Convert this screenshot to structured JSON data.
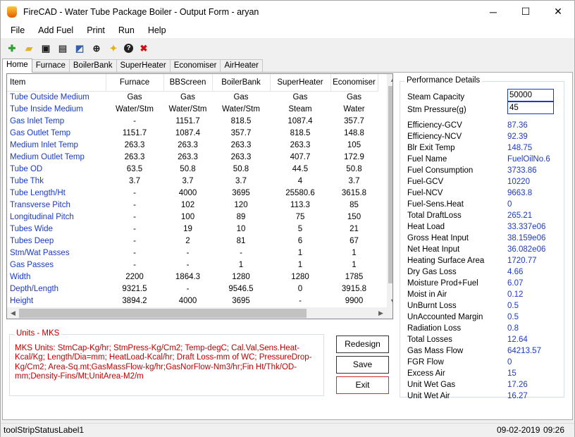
{
  "window": {
    "title": "FireCAD - Water Tube Package Boiler - Output Form - aryan",
    "minimize": "─",
    "maximize": "☐",
    "close": "✕"
  },
  "menu": [
    "File",
    "Add Fuel",
    "Print",
    "Run",
    "Help"
  ],
  "toolbar": [
    {
      "icon": "new-icon",
      "glyph": "✚",
      "color": "#2e9e2e"
    },
    {
      "icon": "open-folder-icon",
      "glyph": "▰",
      "color": "#e0b030"
    },
    {
      "icon": "save-icon",
      "glyph": "▣",
      "color": "#1a1a1a"
    },
    {
      "icon": "print-icon",
      "glyph": "▤",
      "color": "#444"
    },
    {
      "icon": "chart-icon",
      "glyph": "◩",
      "color": "#3060b0"
    },
    {
      "icon": "add-icon",
      "glyph": "⊕",
      "color": "#222"
    },
    {
      "icon": "run-icon",
      "glyph": "✦",
      "color": "#e8b000"
    },
    {
      "icon": "help-icon",
      "glyph": "?",
      "color": "#222"
    },
    {
      "icon": "close-icon",
      "glyph": "✖",
      "color": "#d01010"
    }
  ],
  "tabs": [
    "Home",
    "Furnace",
    "BoilerBank",
    "SuperHeater",
    "Economiser",
    "AirHeater"
  ],
  "grid": {
    "columns": [
      "Item",
      "Furnace",
      "BBScreen",
      "BoilerBank",
      "SuperHeater",
      "Economiser"
    ],
    "rows": [
      [
        "Tube Outside Medium",
        "Gas",
        "Gas",
        "Gas",
        "Gas",
        "Gas"
      ],
      [
        "Tube Inside Medium",
        "Water/Stm",
        "Water/Stm",
        "Water/Stm",
        "Steam",
        "Water"
      ],
      [
        "Gas Inlet Temp",
        "-",
        "1151.7",
        "818.5",
        "1087.4",
        "357.7"
      ],
      [
        "Gas Outlet Temp",
        "1151.7",
        "1087.4",
        "357.7",
        "818.5",
        "148.8"
      ],
      [
        "Medium Inlet Temp",
        "263.3",
        "263.3",
        "263.3",
        "263.3",
        "105"
      ],
      [
        "Medium Outlet Temp",
        "263.3",
        "263.3",
        "263.3",
        "407.7",
        "172.9"
      ],
      [
        "Tube OD",
        "63.5",
        "50.8",
        "50.8",
        "44.5",
        "50.8"
      ],
      [
        "Tube Thk",
        "3.7",
        "3.7",
        "3.7",
        "4",
        "3.7"
      ],
      [
        "Tube Length/Ht",
        "-",
        "4000",
        "3695",
        "25580.6",
        "3615.8"
      ],
      [
        "Transverse Pitch",
        "-",
        "102",
        "120",
        "113.3",
        "85"
      ],
      [
        "Longitudinal Pitch",
        "-",
        "100",
        "89",
        "75",
        "150"
      ],
      [
        "Tubes Wide",
        "-",
        "19",
        "10",
        "5",
        "21"
      ],
      [
        "Tubes Deep",
        "-",
        "2",
        "81",
        "6",
        "67"
      ],
      [
        "Stm/Wat Passes",
        "-",
        "-",
        "-",
        "1",
        "1"
      ],
      [
        "Gas Passes",
        "-",
        "-",
        "1",
        "1",
        "1"
      ],
      [
        "Width",
        "2200",
        "1864.3",
        "1280",
        "1280",
        "1785"
      ],
      [
        "Depth/Length",
        "9321.5",
        "-",
        "9546.5",
        "0",
        "3915.8"
      ],
      [
        "Height",
        "3894.2",
        "4000",
        "3695",
        "-",
        "9900"
      ]
    ]
  },
  "units": {
    "legend": "Units - MKS",
    "text": "MKS Units: StmCap-Kg/hr; StmPress-Kg/Cm2; Temp-degC; Cal.Val,Sens.Heat-Kcal/Kg; Length/Dia=mm; HeatLoad-Kcal/hr; Draft Loss-mm of WC; PressureDrop-Kg/Cm2; Area-Sq.mt;GasMassFlow-kg/hr;GasNorFlow-Nm3/hr;Fin Ht/Thk/OD-mm;Density-Fins/Mt;UnitArea-M2/m"
  },
  "buttons": {
    "redesign": "Redesign",
    "save": "Save",
    "exit": "Exit"
  },
  "performance": {
    "legend": "Performance Details",
    "inputs": [
      {
        "label": "Steam Capacity",
        "value": "50000"
      },
      {
        "label": "Stm Pressure(g)",
        "value": "45"
      }
    ],
    "items": [
      [
        "Efficiency-GCV",
        "87.36"
      ],
      [
        "Efficiency-NCV",
        "92.39"
      ],
      [
        "Blr Exit Temp",
        "148.75"
      ],
      [
        "Fuel Name",
        "FuelOilNo.6"
      ],
      [
        "Fuel Consumption",
        "3733.86"
      ],
      [
        "Fuel-GCV",
        "10220"
      ],
      [
        "Fuel-NCV",
        "9663.8"
      ],
      [
        "Fuel-Sens.Heat",
        "0"
      ],
      [
        "Total DraftLoss",
        "265.21"
      ],
      [
        "Heat Load",
        "33.337e06"
      ],
      [
        "Gross Heat Input",
        "38.159e06"
      ],
      [
        "Net Heat Input",
        "36.082e06"
      ],
      [
        "Heating Surface Area",
        "1720.77"
      ],
      [
        "Dry Gas Loss",
        "4.66"
      ],
      [
        "Moisture Prod+Fuel",
        "6.07"
      ],
      [
        "Moist in Air",
        "0.12"
      ],
      [
        "UnBurnt Loss",
        "0.5"
      ],
      [
        "UnAccounted Margin",
        "0.5"
      ],
      [
        "Radiation Loss",
        "0.8"
      ],
      [
        "Total Losses",
        "12.64"
      ],
      [
        "Gas Mass Flow",
        "64213.57"
      ],
      [
        "FGR Flow",
        "0"
      ],
      [
        "Excess Air",
        "15"
      ],
      [
        "Unit Wet Gas",
        "17.26"
      ],
      [
        "Unit Wet Air",
        "16.27"
      ]
    ]
  },
  "status": {
    "label": "toolStripStatusLabel1",
    "date": "09-02-2019",
    "time": "09:26"
  }
}
